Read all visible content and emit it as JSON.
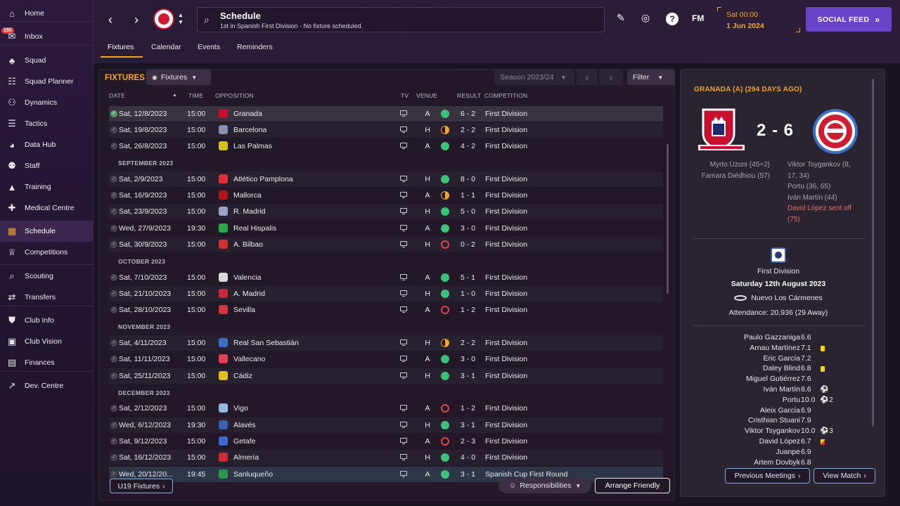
{
  "sidebar": {
    "inbox_badge": "150",
    "items": [
      {
        "label": "Home",
        "icon": "home-icon"
      },
      {
        "label": "Inbox",
        "icon": "inbox-icon"
      },
      {
        "label": "Squad",
        "icon": "shirt-icon"
      },
      {
        "label": "Squad Planner",
        "icon": "clipboard-icon"
      },
      {
        "label": "Dynamics",
        "icon": "people-icon"
      },
      {
        "label": "Tactics",
        "icon": "tactics-icon"
      },
      {
        "label": "Data Hub",
        "icon": "data-hub-icon"
      },
      {
        "label": "Staff",
        "icon": "staff-icon"
      },
      {
        "label": "Training",
        "icon": "training-icon"
      },
      {
        "label": "Medical Centre",
        "icon": "medical-icon"
      },
      {
        "label": "Schedule",
        "icon": "calendar-icon"
      },
      {
        "label": "Competitions",
        "icon": "trophy-icon"
      },
      {
        "label": "Scouting",
        "icon": "scouting-icon"
      },
      {
        "label": "Transfers",
        "icon": "transfers-icon"
      },
      {
        "label": "Club Info",
        "icon": "shield-icon"
      },
      {
        "label": "Club Vision",
        "icon": "briefcase-icon"
      },
      {
        "label": "Finances",
        "icon": "money-icon"
      },
      {
        "label": "Dev. Centre",
        "icon": "dev-centre-icon"
      }
    ]
  },
  "header": {
    "title": "Schedule",
    "subtitle": "1st in Spanish First Division - No fixture scheduled.",
    "fm_label": "FM",
    "date_time": "Sat 00:00",
    "date_day": "1 Jun 2024",
    "social_feed": "SOCIAL FEED",
    "tabs": [
      "Fixtures",
      "Calendar",
      "Events",
      "Reminders"
    ]
  },
  "fixtures": {
    "title": "FIXTURES",
    "view_dropdown": "Fixtures",
    "season": "Season 2023/24",
    "filter": "Filter",
    "columns": {
      "date": "DATE",
      "time": "TIME",
      "opposition": "OPPOSITION",
      "tv": "TV",
      "venue": "VENUE",
      "result": "RESULT",
      "competition": "COMPETITION"
    },
    "months": [
      "SEPTEMBER 2023",
      "OCTOBER 2023",
      "NOVEMBER 2023",
      "DECEMBER 2023"
    ],
    "rows": [
      {
        "date": "Sat, 12/8/2023",
        "time": "15:00",
        "opp": "Granada",
        "venue": "A",
        "res": "w",
        "score": "6 - 2",
        "comp": "First Division",
        "crest": "#c8102e"
      },
      {
        "date": "Sat, 19/8/2023",
        "time": "15:00",
        "opp": "Barcelona",
        "venue": "H",
        "res": "d",
        "score": "2 - 2",
        "comp": "First Division",
        "crest": "#8a8fb0"
      },
      {
        "date": "Sat, 26/8/2023",
        "time": "15:00",
        "opp": "Las Palmas",
        "venue": "A",
        "res": "w",
        "score": "4 - 2",
        "comp": "First Division",
        "crest": "#d6c21a"
      },
      {
        "date": "Sat, 2/9/2023",
        "time": "15:00",
        "opp": "Atlético Pamplona",
        "venue": "H",
        "res": "w",
        "score": "8 - 0",
        "comp": "First Division",
        "crest": "#e0303a"
      },
      {
        "date": "Sat, 16/9/2023",
        "time": "15:00",
        "opp": "Mallorca",
        "venue": "A",
        "res": "d",
        "score": "1 - 1",
        "comp": "First Division",
        "crest": "#b01818"
      },
      {
        "date": "Sat, 23/9/2023",
        "time": "15:00",
        "opp": "R. Madrid",
        "venue": "H",
        "res": "w",
        "score": "5 - 0",
        "comp": "First Division",
        "crest": "#9aa2c8"
      },
      {
        "date": "Wed, 27/9/2023",
        "time": "19:30",
        "opp": "Real Hispalis",
        "venue": "A",
        "res": "w",
        "score": "3 - 0",
        "comp": "First Division",
        "crest": "#2aa84a"
      },
      {
        "date": "Sat, 30/9/2023",
        "time": "15:00",
        "opp": "A. Bilbao",
        "venue": "H",
        "res": "l",
        "score": "0 - 2",
        "comp": "First Division",
        "crest": "#d03030"
      },
      {
        "date": "Sat, 7/10/2023",
        "time": "15:00",
        "opp": "Valencia",
        "venue": "A",
        "res": "w",
        "score": "5 - 1",
        "comp": "First Division",
        "crest": "#d8d8d8"
      },
      {
        "date": "Sat, 21/10/2023",
        "time": "15:00",
        "opp": "A. Madrid",
        "venue": "H",
        "res": "w",
        "score": "1 - 0",
        "comp": "First Division",
        "crest": "#c82838"
      },
      {
        "date": "Sat, 28/10/2023",
        "time": "15:00",
        "opp": "Sevilla",
        "venue": "A",
        "res": "l",
        "score": "1 - 2",
        "comp": "First Division",
        "crest": "#e03040"
      },
      {
        "date": "Sat, 4/11/2023",
        "time": "15:00",
        "opp": "Real San Sebastián",
        "venue": "H",
        "res": "d",
        "score": "2 - 2",
        "comp": "First Division",
        "crest": "#3a70c8"
      },
      {
        "date": "Sat, 11/11/2023",
        "time": "15:00",
        "opp": "Vallecano",
        "venue": "A",
        "res": "w",
        "score": "3 - 0",
        "comp": "First Division",
        "crest": "#e04050"
      },
      {
        "date": "Sat, 25/11/2023",
        "time": "15:00",
        "opp": "Cádiz",
        "venue": "H",
        "res": "w",
        "score": "3 - 1",
        "comp": "First Division",
        "crest": "#e0c020"
      },
      {
        "date": "Sat, 2/12/2023",
        "time": "15:00",
        "opp": "Vigo",
        "venue": "A",
        "res": "l",
        "score": "1 - 2",
        "comp": "First Division",
        "crest": "#90b8e0"
      },
      {
        "date": "Wed, 6/12/2023",
        "time": "19:30",
        "opp": "Alavés",
        "venue": "H",
        "res": "w",
        "score": "3 - 1",
        "comp": "First Division",
        "crest": "#3a60b0"
      },
      {
        "date": "Sat, 9/12/2023",
        "time": "15:00",
        "opp": "Getafe",
        "venue": "A",
        "res": "l",
        "score": "2 - 3",
        "comp": "First Division",
        "crest": "#3a6ad0"
      },
      {
        "date": "Sat, 16/12/2023",
        "time": "15:00",
        "opp": "Almería",
        "venue": "H",
        "res": "w",
        "score": "4 - 0",
        "comp": "First Division",
        "crest": "#d02838"
      },
      {
        "date": "Wed, 20/12/20...",
        "time": "19:45",
        "opp": "Sanluqueño",
        "venue": "A",
        "res": "w",
        "score": "3 - 1",
        "comp": "Spanish Cup First Round",
        "crest": "#2a9a4a"
      }
    ],
    "u19_button": "U19 Fixtures",
    "responsibilities": "Responsibilities",
    "arrange_friendly": "Arrange Friendly"
  },
  "match": {
    "heading": "GRANADA (A) (294 DAYS AGO)",
    "score": "2 - 6",
    "home_scorers": [
      "Myrto Uzuni (45+2)",
      "Famara Diédhiou (57)"
    ],
    "away_scorers": [
      "Viktor Tsygankov (8,",
      "17, 34)",
      "Portu (36, 65)",
      "Iván Martín (44)"
    ],
    "sent_off": [
      "David López sent off",
      "(75)"
    ],
    "competition": "First Division",
    "date": "Saturday 12th August 2023",
    "stadium": "Nuevo Los Cármenes",
    "attendance": "Attendance: 20,936 (29 Away)",
    "lineup": [
      {
        "name": "Paulo Gazzaniga",
        "rating": "6.6"
      },
      {
        "name": "Arnau Martínez",
        "rating": "7.1",
        "card": "yellow"
      },
      {
        "name": "Eric García",
        "rating": "7.2"
      },
      {
        "name": "Daley Blind",
        "rating": "6.8",
        "card": "yellow"
      },
      {
        "name": "Miguel Gutiérrez",
        "rating": "7.6"
      },
      {
        "name": "Iván Martín",
        "rating": "8.6",
        "goals": ""
      },
      {
        "name": "Portu",
        "rating": "10.0",
        "goals": "2"
      },
      {
        "name": "Aleix García",
        "rating": "6.9"
      },
      {
        "name": "Cristhian Stuani",
        "rating": "7.9"
      },
      {
        "name": "Viktor Tsygankov",
        "rating": "10.0",
        "goals": "3"
      },
      {
        "name": "David López",
        "rating": "6.7",
        "card": "red"
      },
      {
        "name": "Juanpe",
        "rating": "6.9"
      },
      {
        "name": "Artem Dovbyk",
        "rating": "6.8"
      }
    ],
    "prev_meetings": "Previous Meetings",
    "view_match": "View Match"
  },
  "colors": {
    "accent": "#f5a623",
    "win": "#3fc07a",
    "loss": "#e0444f",
    "social": "#6a45c9"
  }
}
